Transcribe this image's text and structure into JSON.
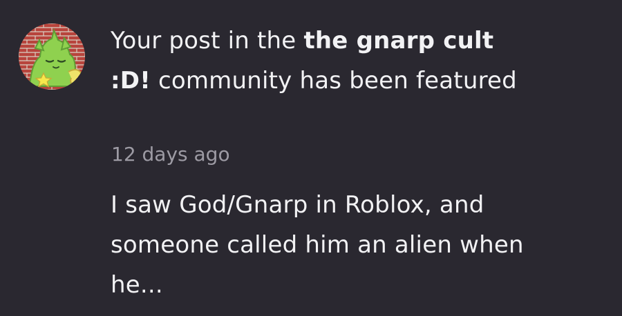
{
  "notification": {
    "avatar_icon": "green-cat-avatar-icon",
    "title_prefix": "Your post in the ",
    "community_name": "the gnarp cult :D!",
    "title_suffix": " community has been featured",
    "timestamp": "12 days ago",
    "post_preview": "I saw God/Gnarp in Roblox, and someone called him an alien when he..."
  },
  "colors": {
    "background": "#2a2830",
    "text": "#f2f2f4",
    "muted_text": "#9d9ba4",
    "avatar_brick": "#b8443c",
    "avatar_creature": "#8fd14f"
  }
}
